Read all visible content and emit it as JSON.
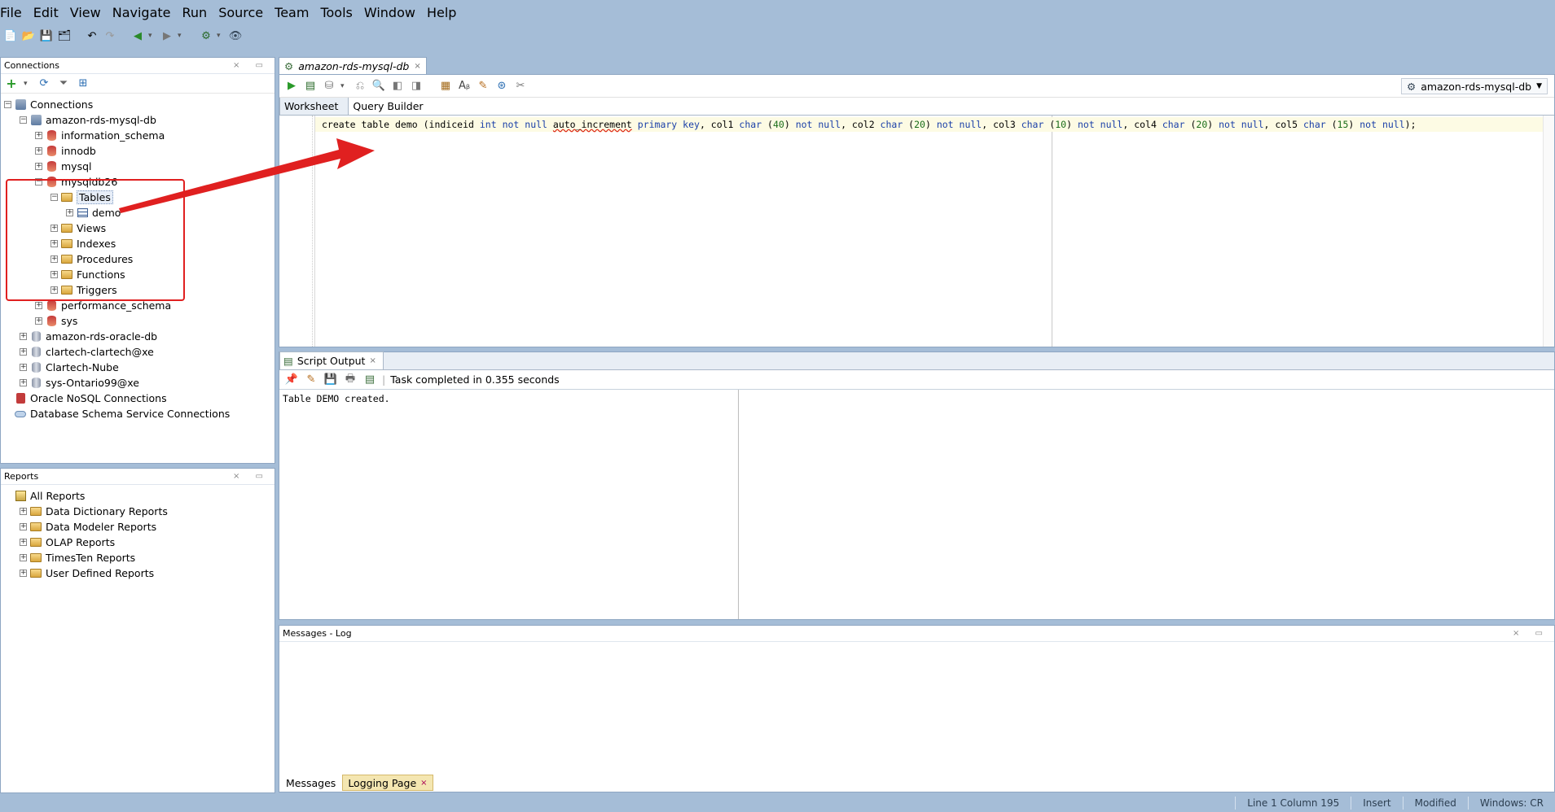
{
  "menu": [
    "File",
    "Edit",
    "View",
    "Navigate",
    "Run",
    "Source",
    "Team",
    "Tools",
    "Window",
    "Help"
  ],
  "connections_panel": {
    "title": "Connections",
    "tree": [
      {
        "label": "Connections",
        "indent": 0,
        "icon": "connections-folder-icon",
        "exp": "-"
      },
      {
        "label": "amazon-rds-mysql-db",
        "indent": 1,
        "icon": "database-connection-icon",
        "exp": "-"
      },
      {
        "label": "information_schema",
        "indent": 2,
        "icon": "schema-icon",
        "exp": "+"
      },
      {
        "label": "innodb",
        "indent": 2,
        "icon": "schema-icon",
        "exp": "+"
      },
      {
        "label": "mysql",
        "indent": 2,
        "icon": "schema-icon",
        "exp": "+"
      },
      {
        "label": "mysqldb26",
        "indent": 2,
        "icon": "schema-icon",
        "exp": "-"
      },
      {
        "label": "Tables",
        "indent": 3,
        "icon": "tables-folder-icon",
        "exp": "-",
        "selected": true
      },
      {
        "label": "demo",
        "indent": 4,
        "icon": "table-icon",
        "exp": "+"
      },
      {
        "label": "Views",
        "indent": 3,
        "icon": "views-folder-icon",
        "exp": "+"
      },
      {
        "label": "Indexes",
        "indent": 3,
        "icon": "indexes-folder-icon",
        "exp": "+"
      },
      {
        "label": "Procedures",
        "indent": 3,
        "icon": "procedures-folder-icon",
        "exp": "+"
      },
      {
        "label": "Functions",
        "indent": 3,
        "icon": "functions-folder-icon",
        "exp": "+"
      },
      {
        "label": "Triggers",
        "indent": 3,
        "icon": "triggers-folder-icon",
        "exp": "+"
      },
      {
        "label": "performance_schema",
        "indent": 2,
        "icon": "schema-icon",
        "exp": "+"
      },
      {
        "label": "sys",
        "indent": 2,
        "icon": "schema-icon",
        "exp": "+"
      },
      {
        "label": "amazon-rds-oracle-db",
        "indent": 1,
        "icon": "oracle-connection-icon",
        "exp": "+"
      },
      {
        "label": "clartech-clartech@xe",
        "indent": 1,
        "icon": "oracle-connection-icon",
        "exp": "+"
      },
      {
        "label": "Clartech-Nube",
        "indent": 1,
        "icon": "oracle-connection-icon",
        "exp": "+"
      },
      {
        "label": "sys-Ontario99@xe",
        "indent": 1,
        "icon": "oracle-connection-icon",
        "exp": "+"
      },
      {
        "label": "Oracle NoSQL Connections",
        "indent": 0,
        "icon": "nosql-icon",
        "exp": ""
      },
      {
        "label": "Database Schema Service Connections",
        "indent": 0,
        "icon": "cloud-icon",
        "exp": ""
      }
    ]
  },
  "reports_panel": {
    "title": "Reports",
    "tree": [
      {
        "label": "All Reports",
        "indent": 0,
        "icon": "reports-icon",
        "exp": ""
      },
      {
        "label": "Data Dictionary Reports",
        "indent": 1,
        "icon": "folder-icon",
        "exp": "+"
      },
      {
        "label": "Data Modeler Reports",
        "indent": 1,
        "icon": "folder-icon",
        "exp": "+"
      },
      {
        "label": "OLAP Reports",
        "indent": 1,
        "icon": "folder-icon",
        "exp": "+"
      },
      {
        "label": "TimesTen Reports",
        "indent": 1,
        "icon": "folder-icon",
        "exp": "+"
      },
      {
        "label": "User Defined Reports",
        "indent": 1,
        "icon": "folder-icon",
        "exp": "+"
      }
    ]
  },
  "editor": {
    "tab_label": "amazon-rds-mysql-db",
    "connection_select": "amazon-rds-mysql-db",
    "subtabs": [
      "Worksheet",
      "Query Builder"
    ],
    "code": [
      {
        "t": "create table demo (indiceid ",
        "c": ""
      },
      {
        "t": "int",
        "c": "kw"
      },
      {
        "t": " not null ",
        "c": "kw"
      },
      {
        "t": "auto_increment",
        "c": "err"
      },
      {
        "t": " primary key",
        "c": "kw"
      },
      {
        "t": ", col1 ",
        "c": ""
      },
      {
        "t": "char",
        "c": "kw"
      },
      {
        "t": " (",
        "c": ""
      },
      {
        "t": "40",
        "c": "num"
      },
      {
        "t": ") ",
        "c": ""
      },
      {
        "t": "not null",
        "c": "kw"
      },
      {
        "t": ", col2 ",
        "c": ""
      },
      {
        "t": "char",
        "c": "kw"
      },
      {
        "t": " (",
        "c": ""
      },
      {
        "t": "20",
        "c": "num"
      },
      {
        "t": ") ",
        "c": ""
      },
      {
        "t": "not null",
        "c": "kw"
      },
      {
        "t": ", col3 ",
        "c": ""
      },
      {
        "t": "char",
        "c": "kw"
      },
      {
        "t": " (",
        "c": ""
      },
      {
        "t": "10",
        "c": "num"
      },
      {
        "t": ") ",
        "c": ""
      },
      {
        "t": "not null",
        "c": "kw"
      },
      {
        "t": ", col4 ",
        "c": ""
      },
      {
        "t": "char",
        "c": "kw"
      },
      {
        "t": " (",
        "c": ""
      },
      {
        "t": "20",
        "c": "num"
      },
      {
        "t": ") ",
        "c": ""
      },
      {
        "t": "not null",
        "c": "kw"
      },
      {
        "t": ", col5 ",
        "c": ""
      },
      {
        "t": "char",
        "c": "kw"
      },
      {
        "t": " (",
        "c": ""
      },
      {
        "t": "15",
        "c": "num"
      },
      {
        "t": ") ",
        "c": ""
      },
      {
        "t": "not null",
        "c": "kw"
      },
      {
        "t": ");",
        "c": ""
      }
    ]
  },
  "output": {
    "tab_label": "Script Output",
    "status": "Task completed in 0.355 seconds",
    "text": "Table DEMO created."
  },
  "messages": {
    "title": "Messages - Log",
    "tabs": [
      "Messages",
      "Logging Page"
    ]
  },
  "statusbar": [
    "Line 1 Column 195",
    "Insert",
    "Modified",
    "Windows: CR"
  ],
  "colors": {
    "accent": "#a5bdd7",
    "annotation": "#e02020",
    "keyword": "#1a3fa8",
    "number": "#1a6d1a"
  }
}
